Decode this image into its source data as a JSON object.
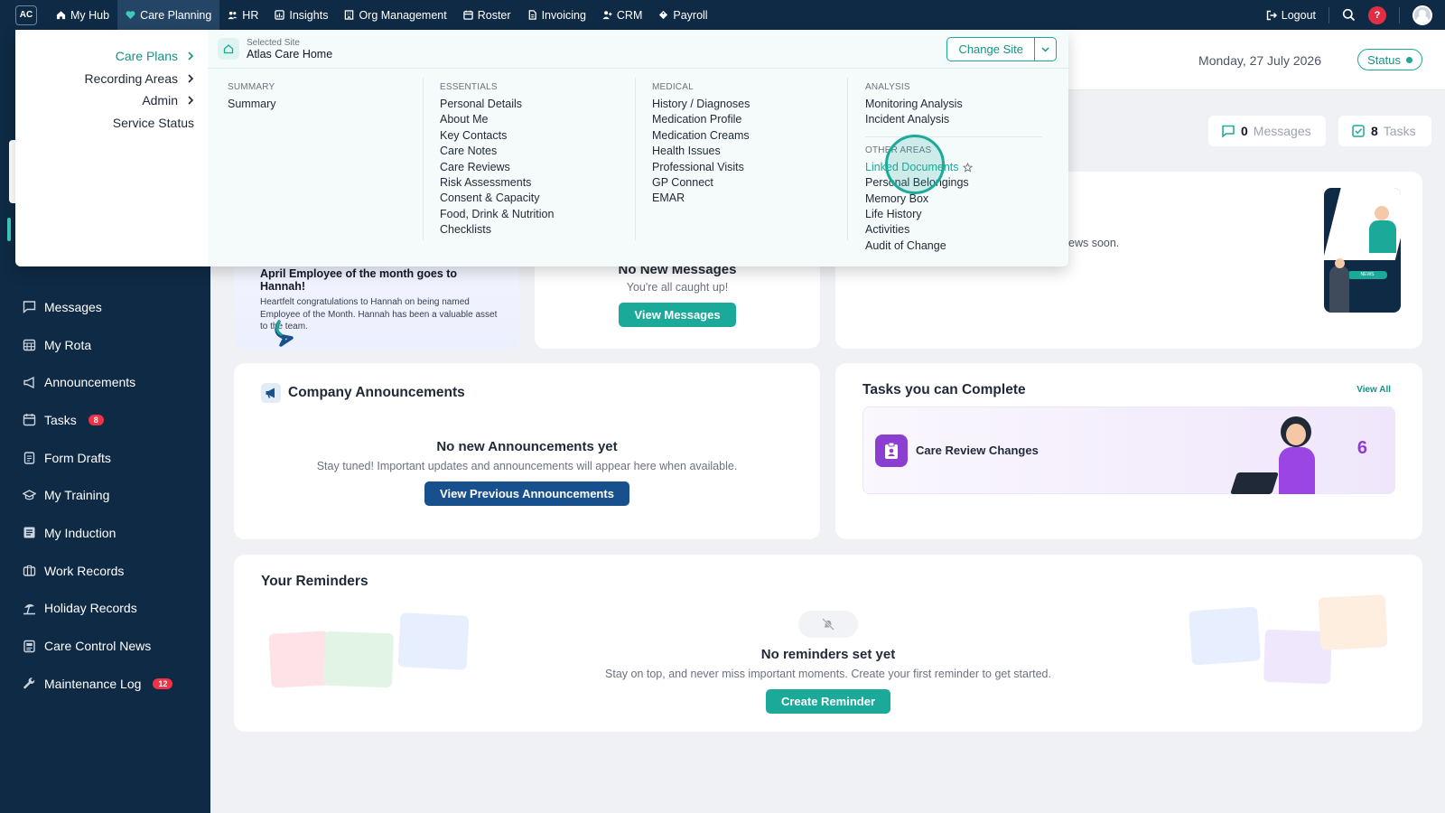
{
  "topbar": {
    "logo": "AC",
    "nav": [
      {
        "label": "My Hub",
        "icon": "home-icon",
        "active": false
      },
      {
        "label": "Care Planning",
        "icon": "heart-icon",
        "active": true
      },
      {
        "label": "HR",
        "icon": "people-icon",
        "active": false
      },
      {
        "label": "Insights",
        "icon": "chart-icon",
        "active": false
      },
      {
        "label": "Org Management",
        "icon": "building-icon",
        "active": false
      },
      {
        "label": "Roster",
        "icon": "calendar-icon",
        "active": false
      },
      {
        "label": "Invoicing",
        "icon": "document-icon",
        "active": false
      },
      {
        "label": "CRM",
        "icon": "user-plus-icon",
        "active": false
      },
      {
        "label": "Payroll",
        "icon": "tag-icon",
        "active": false
      }
    ],
    "logout": "Logout",
    "help": "?"
  },
  "sidebar": {
    "items": [
      {
        "label": "Messages",
        "icon": "message-icon",
        "badge": ""
      },
      {
        "label": "My Rota",
        "icon": "calendar-grid-icon",
        "badge": ""
      },
      {
        "label": "Announcements",
        "icon": "megaphone-icon",
        "badge": ""
      },
      {
        "label": "Tasks",
        "icon": "calendar-icon",
        "badge": "8"
      },
      {
        "label": "Form Drafts",
        "icon": "clipboard-icon",
        "badge": ""
      },
      {
        "label": "My Training",
        "icon": "graduation-cap-icon",
        "badge": ""
      },
      {
        "label": "My Induction",
        "icon": "list-icon",
        "badge": ""
      },
      {
        "label": "Work Records",
        "icon": "briefcase-icon",
        "badge": ""
      },
      {
        "label": "Holiday Records",
        "icon": "beach-umbrella-icon",
        "badge": ""
      },
      {
        "label": "Care Control News",
        "icon": "newspaper-icon",
        "badge": ""
      },
      {
        "label": "Maintenance Log",
        "icon": "wrench-icon",
        "badge": "12"
      }
    ]
  },
  "header": {
    "date": "Monday, 27 July 2026",
    "status": "Status"
  },
  "chips": {
    "messages_count": "0",
    "messages_label": "Messages",
    "tasks_count": "8",
    "tasks_label": "Tasks"
  },
  "employee": {
    "title": "April Employee of the month goes to Hannah!",
    "body": "Heartfelt congratulations to Hannah on being named Employee of the Month. Hannah has been a valuable asset to the team."
  },
  "messages_card": {
    "title": "No New Messages",
    "subtitle": "You're all caught up!",
    "button": "View Messages"
  },
  "news_card": {
    "partial_text": "ews soon.",
    "banner": "NEWS"
  },
  "announcements": {
    "title": "Company Announcements",
    "empty_title": "No new Announcements yet",
    "empty_text": "Stay tuned! Important updates and announcements will appear here when available.",
    "button": "View Previous Announcements"
  },
  "tasks_card": {
    "title": "Tasks you can Complete",
    "view_all": "View All",
    "item_label": "Care Review Changes",
    "item_count": "6"
  },
  "reminders": {
    "title": "Your Reminders",
    "empty_title": "No reminders set yet",
    "empty_text": "Stay on top, and never miss important moments. Create your first reminder to get started.",
    "button": "Create Reminder"
  },
  "dropdown": {
    "left": [
      {
        "label": "Care Plans",
        "active": true
      },
      {
        "label": "Recording Areas",
        "active": false
      },
      {
        "label": "Admin",
        "active": false
      },
      {
        "label": "Service Status",
        "active": false
      }
    ],
    "site_small": "Selected Site",
    "site_name": "Atlas Care Home",
    "change_site": "Change Site",
    "columns": [
      {
        "head": "SUMMARY",
        "links": [
          "Summary"
        ]
      },
      {
        "head": "ESSENTIALS",
        "links": [
          "Personal Details",
          "About Me",
          "Key Contacts",
          "Care Notes",
          "Care Reviews",
          "Risk Assessments",
          "Consent & Capacity",
          "Food, Drink & Nutrition",
          "Checklists"
        ]
      },
      {
        "head": "MEDICAL",
        "links": [
          "History / Diagnoses",
          "Medication Profile",
          "Medication Creams",
          "Health Issues",
          "Professional Visits",
          "GP Connect",
          "EMAR"
        ]
      },
      {
        "head": "ANALYSIS",
        "links": [
          "Monitoring Analysis",
          "Incident Analysis"
        ]
      }
    ],
    "other_head": "OTHER AREAS",
    "other_links": [
      "Linked Documents",
      "Personal Belongings",
      "Memory Box",
      "Life History",
      "Activities",
      "Audit of Change"
    ]
  },
  "colors": {
    "navy": "#0f2a44",
    "teal": "#1ba999",
    "button_navy": "#17508d",
    "badge_red": "#ef3347",
    "task_purple": "#8b3fd1"
  }
}
